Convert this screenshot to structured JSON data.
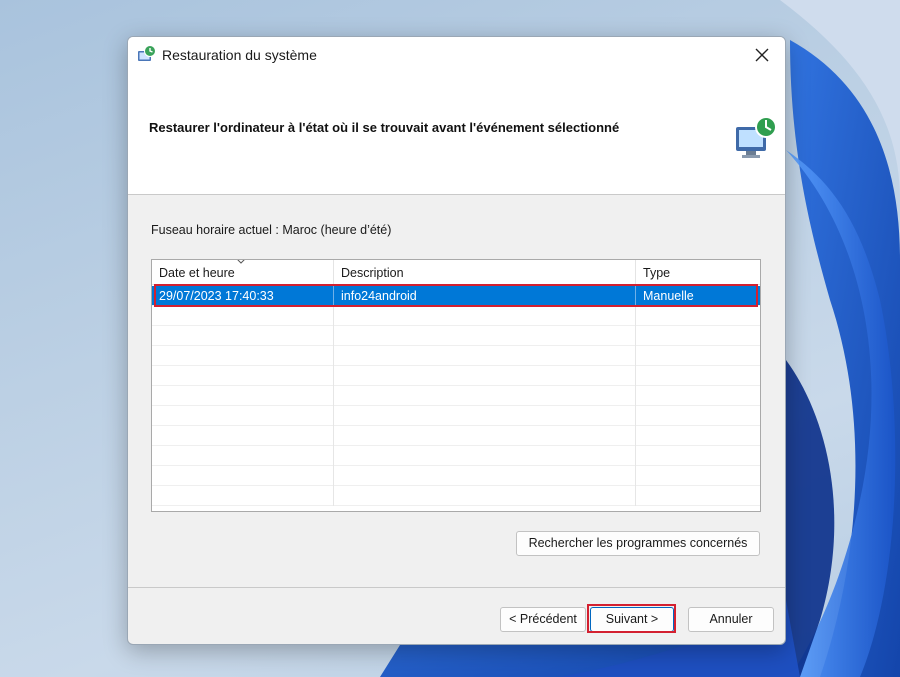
{
  "window": {
    "title": "Restauration du système",
    "close_icon": "close-icon",
    "app_icon": "system-restore-icon"
  },
  "header": {
    "title": "Restaurer l'ordinateur à l'état où il se trouvait avant l'événement sélectionné",
    "icon": "restore-computer-icon"
  },
  "timezone": "Fuseau horaire actuel : Maroc (heure d’été)",
  "table": {
    "columns": [
      "Date et heure",
      "Description",
      "Type"
    ],
    "sort_indicator": "sort-down-caret",
    "rows": [
      {
        "date": "29/07/2023 17:40:33",
        "description": "info24android",
        "type": "Manuelle",
        "selected": true
      }
    ],
    "empty_rows": 10
  },
  "buttons": {
    "find_programs": "Rechercher les programmes concernés",
    "previous": "< Précédent",
    "next": "Suivant >",
    "cancel": "Annuler"
  },
  "colors": {
    "selection": "#0078d7",
    "highlight_box": "#d32030",
    "accent": "#0067c0"
  }
}
